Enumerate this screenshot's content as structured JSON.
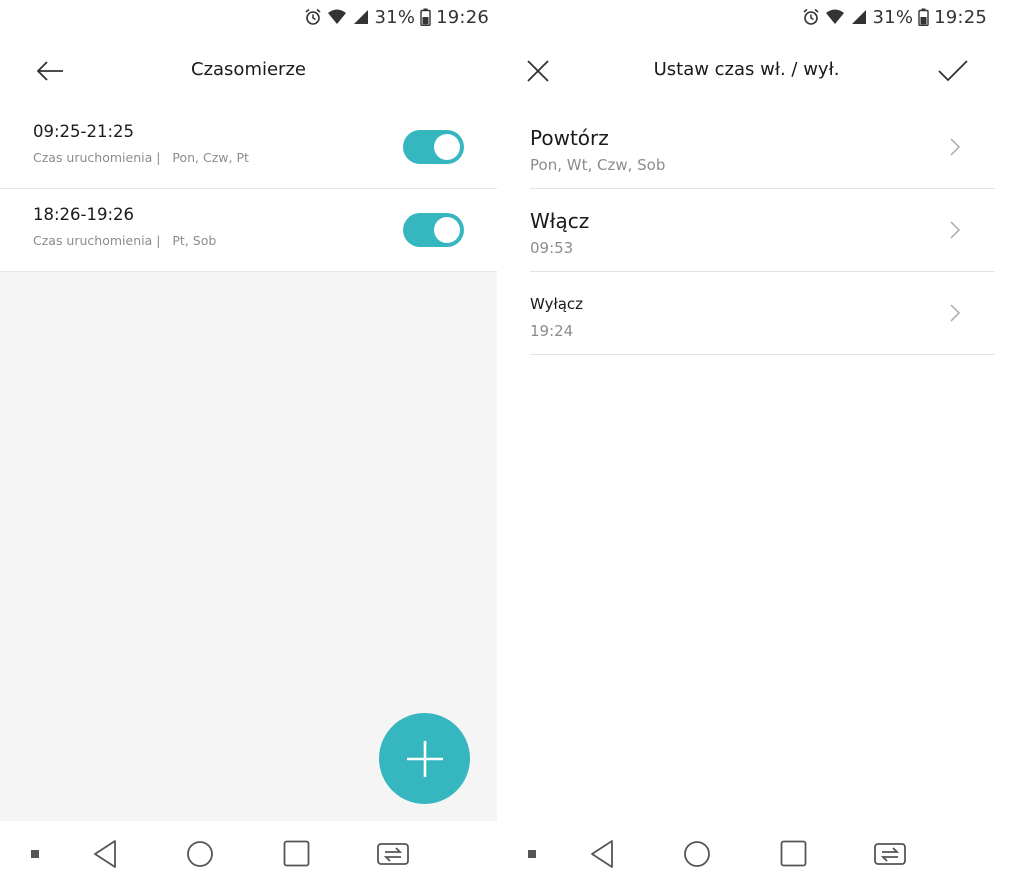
{
  "status_left": {
    "battery": "31%",
    "time": "19:26"
  },
  "status_right": {
    "battery": "31%",
    "time": "19:25"
  },
  "timers_screen": {
    "title": "Czasomierze",
    "timers": [
      {
        "time": "09:25-21:25",
        "label": "Czas uruchomienia |",
        "days": "Pon, Czw, Pt",
        "enabled": true
      },
      {
        "time": "18:26-19:26",
        "label": "Czas uruchomienia |",
        "days": "Pt, Sob",
        "enabled": true
      }
    ]
  },
  "set_time_screen": {
    "title": "Ustaw czas wł. / wył.",
    "rows": [
      {
        "label": "Powtórz",
        "value": "Pon, Wt, Czw, Sob"
      },
      {
        "label": "Włącz",
        "value": "09:53"
      },
      {
        "label": "Wyłącz",
        "value": "19:24"
      }
    ]
  },
  "colors": {
    "accent": "#36b6bf",
    "background_empty": "#f5f5f5",
    "divider": "#e6e6e6",
    "secondary_text": "#8c8c8c"
  },
  "icons": {
    "status": [
      "alarm-icon",
      "wifi-icon",
      "signal-icon",
      "battery-icon"
    ],
    "nav": [
      "menu-dot-icon",
      "back-triangle-icon",
      "home-circle-icon",
      "recents-square-icon",
      "screen-share-icon"
    ]
  }
}
